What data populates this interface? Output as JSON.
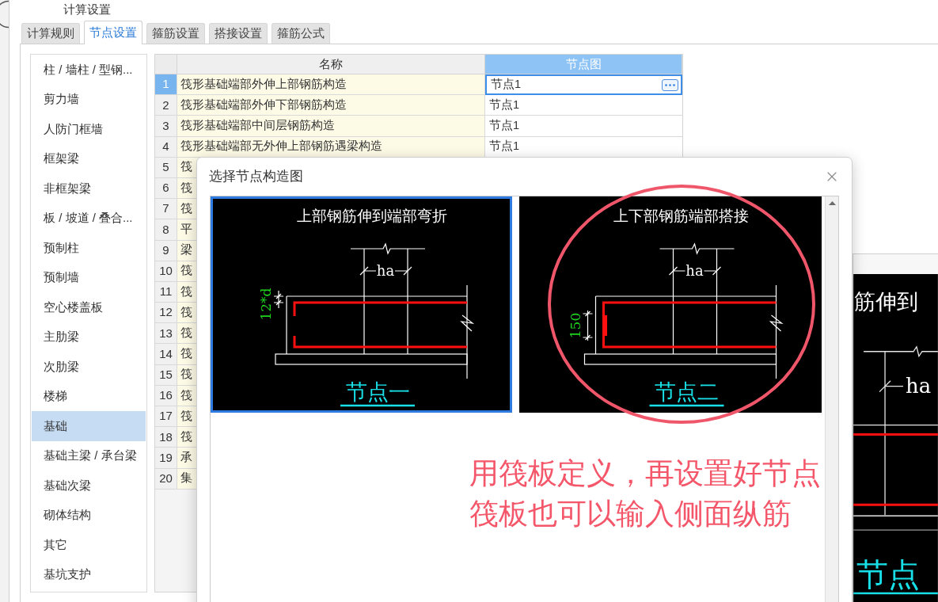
{
  "window": {
    "title": "计算设置"
  },
  "tabs": [
    {
      "label": "计算规则",
      "selected": false
    },
    {
      "label": "节点设置",
      "selected": true
    },
    {
      "label": "箍筋设置",
      "selected": false
    },
    {
      "label": "搭接设置",
      "selected": false
    },
    {
      "label": "箍筋公式",
      "selected": false
    }
  ],
  "categories": [
    {
      "label": "柱 / 墙柱 / 型钢...",
      "selected": false
    },
    {
      "label": "剪力墙",
      "selected": false
    },
    {
      "label": "人防门框墙",
      "selected": false
    },
    {
      "label": "框架梁",
      "selected": false
    },
    {
      "label": "非框架梁",
      "selected": false
    },
    {
      "label": "板 / 坡道 / 叠合...",
      "selected": false
    },
    {
      "label": "预制柱",
      "selected": false
    },
    {
      "label": "预制墙",
      "selected": false
    },
    {
      "label": "空心楼盖板",
      "selected": false
    },
    {
      "label": "主肋梁",
      "selected": false
    },
    {
      "label": "次肋梁",
      "selected": false
    },
    {
      "label": "楼梯",
      "selected": false
    },
    {
      "label": "基础",
      "selected": true
    },
    {
      "label": "基础主梁 / 承台梁",
      "selected": false
    },
    {
      "label": "基础次梁",
      "selected": false
    },
    {
      "label": "砌体结构",
      "selected": false
    },
    {
      "label": "其它",
      "selected": false
    },
    {
      "label": "基坑支护",
      "selected": false
    }
  ],
  "table": {
    "columns": [
      {
        "label": "名称",
        "selected": false
      },
      {
        "label": "节点图",
        "selected": true
      }
    ],
    "rows": [
      {
        "number": "1",
        "name": "筏形基础端部外伸上部钢筋构造",
        "node": "节点1",
        "selected": true
      },
      {
        "number": "2",
        "name": "筏形基础端部外伸下部钢筋构造",
        "node": "节点1",
        "selected": false
      },
      {
        "number": "3",
        "name": "筏形基础端部中间层钢筋构造",
        "node": "节点1",
        "selected": false
      },
      {
        "number": "4",
        "name": "筏形基础端部无外伸上部钢筋遇梁构造",
        "node": "节点1",
        "selected": false
      },
      {
        "number": "5",
        "name": "筏",
        "selected": false
      },
      {
        "number": "6",
        "name": "筏",
        "selected": false
      },
      {
        "number": "7",
        "name": "筏",
        "selected": false
      },
      {
        "number": "8",
        "name": "平",
        "selected": false
      },
      {
        "number": "9",
        "name": "梁",
        "selected": false
      },
      {
        "number": "10",
        "name": "筏",
        "selected": false
      },
      {
        "number": "11",
        "name": "筏",
        "selected": false
      },
      {
        "number": "12",
        "name": "筏",
        "selected": false
      },
      {
        "number": "13",
        "name": "筏",
        "selected": false
      },
      {
        "number": "14",
        "name": "筏",
        "selected": false
      },
      {
        "number": "15",
        "name": "筏",
        "selected": false
      },
      {
        "number": "16",
        "name": "筏",
        "selected": false
      },
      {
        "number": "17",
        "name": "筏",
        "selected": false
      },
      {
        "number": "18",
        "name": "筏",
        "selected": false
      },
      {
        "number": "19",
        "name": "承",
        "selected": false
      },
      {
        "number": "20",
        "name": "集",
        "selected": false
      }
    ]
  },
  "dialog": {
    "title": "选择节点构造图",
    "options": [
      {
        "kind": "bend",
        "title": "上部钢筋伸到端部弯折",
        "width_label": "ha",
        "dimension": "12*d",
        "label": "节点一",
        "selected": true
      },
      {
        "kind": "lap",
        "title": "上下部钢筋端部搭接",
        "width_label": "ha",
        "dimension": "150",
        "label": "节点二",
        "selected": false
      }
    ]
  },
  "annotation": {
    "lines": [
      "用筏板定义，再设置好节点",
      "筏板也可以输入侧面纵筋"
    ]
  },
  "preview": {
    "title": "筋伸到",
    "width_label": "ha",
    "label": "节点"
  }
}
